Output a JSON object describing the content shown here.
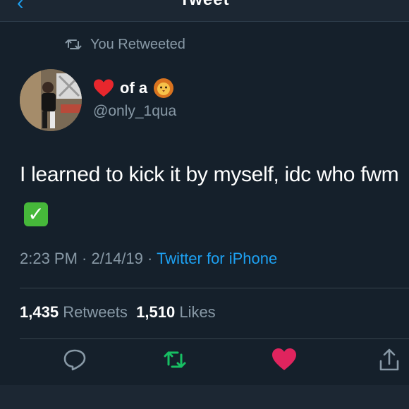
{
  "header": {
    "title": "Tweet"
  },
  "retweet_label": "You Retweeted",
  "user": {
    "display_name_text": "of a",
    "display_name_prefix_emoji": "red-heart-emoji",
    "display_name_suffix_emoji": "lion-face-emoji",
    "handle": "@only_1qua"
  },
  "tweet": {
    "text": "I learned to kick it by myself, idc who fwm",
    "trailing_emoji": "check-mark-button-emoji",
    "time": "2:23 PM",
    "date": "2/14/19",
    "source": "Twitter for iPhone",
    "separator": " · "
  },
  "stats": {
    "retweets_count": "1,435",
    "retweets_label": "Retweets",
    "likes_count": "1,510",
    "likes_label": "Likes"
  },
  "actions": [
    {
      "icon": "reply-icon"
    },
    {
      "icon": "retweet-icon",
      "active": true,
      "color": "#17bf63"
    },
    {
      "icon": "heart-icon",
      "active": true,
      "color": "#e0245e"
    },
    {
      "icon": "share-icon"
    }
  ],
  "colors": {
    "background": "#15202b",
    "accent": "#1da1f2",
    "muted": "#8899a6",
    "retweet_active": "#17bf63",
    "like_active": "#e0245e"
  }
}
